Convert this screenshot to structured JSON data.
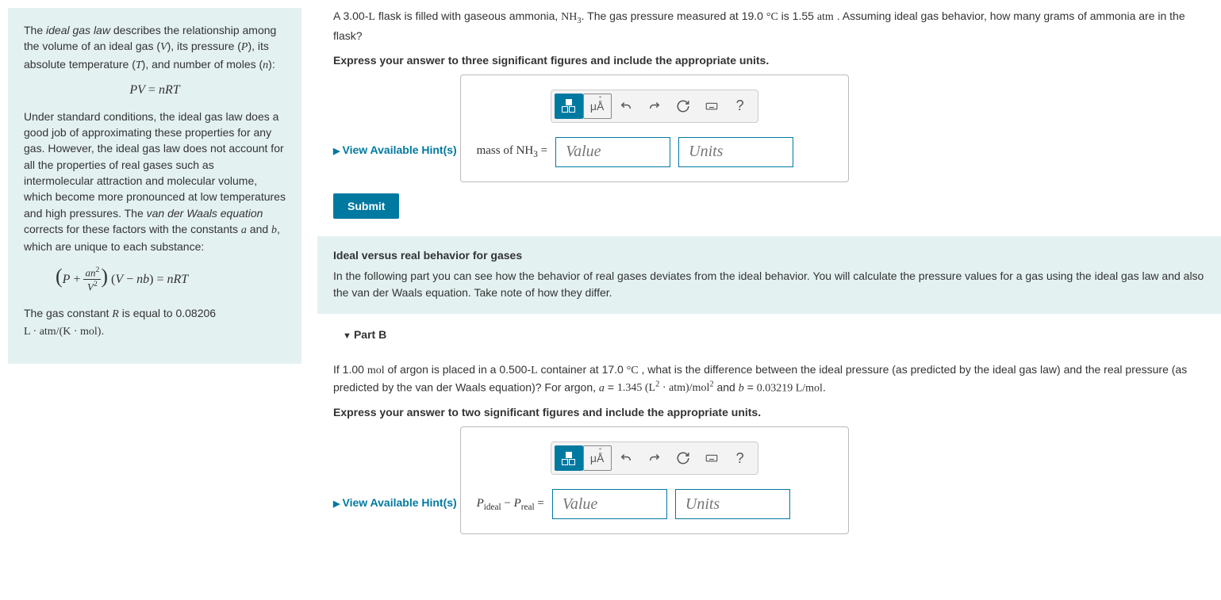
{
  "sidebar": {
    "intro": "The ideal gas law describes the relationship among the volume of an ideal gas (V), its pressure (P), its absolute temperature (T), and number of moles (n):",
    "eq1": "PV = nRT",
    "para2": "Under standard conditions, the ideal gas law does a good job of approximating these properties for any gas. However, the ideal gas law does not account for all the properties of real gases such as intermolecular attraction and molecular volume, which become more pronounced at low temperatures and high pressures. The van der Waals equation corrects for these factors with the constants a and b, which are unique to each substance:",
    "para3_a": "The gas constant R is equal to 0.08206 ",
    "para3_b": "L · atm/(K · mol)"
  },
  "partA": {
    "question_a": "A 3.00-",
    "question_b": " flask is filled with gaseous ammonia, ",
    "question_c": ". The gas pressure measured at 19.0 ",
    "question_d": " is 1.55 ",
    "question_e": " . Assuming ideal gas behavior, how many grams of ammonia are in the flask?",
    "instruction": "Express your answer to three significant figures and include the appropriate units.",
    "hints": "View Available Hint(s)",
    "label": "mass of NH₃ = ",
    "value_ph": "Value",
    "units_ph": "Units",
    "submit": "Submit"
  },
  "banner": {
    "title": "Ideal versus real behavior for gases",
    "text": "In the following part you can see how the behavior of real gases deviates from the ideal behavior. You will calculate the pressure values for a gas using the ideal gas law and also the van der Waals equation. Take note of how they differ."
  },
  "partB": {
    "header": "Part B",
    "q_a": "If 1.00 ",
    "q_b": " of argon is placed in a 0.500-",
    "q_c": " container at 17.0 ",
    "q_d": " , what is the difference between the ideal pressure (as predicted by the ideal gas law) and the real pressure (as predicted by the van der Waals equation)? For argon, ",
    "q_e": " and ",
    "q_f": ".",
    "instruction": "Express your answer to two significant figures and include the appropriate units.",
    "hints": "View Available Hint(s)",
    "value_ph": "Value",
    "units_ph": "Units"
  },
  "tool": {
    "units_label": "μÅ",
    "help": "?"
  }
}
